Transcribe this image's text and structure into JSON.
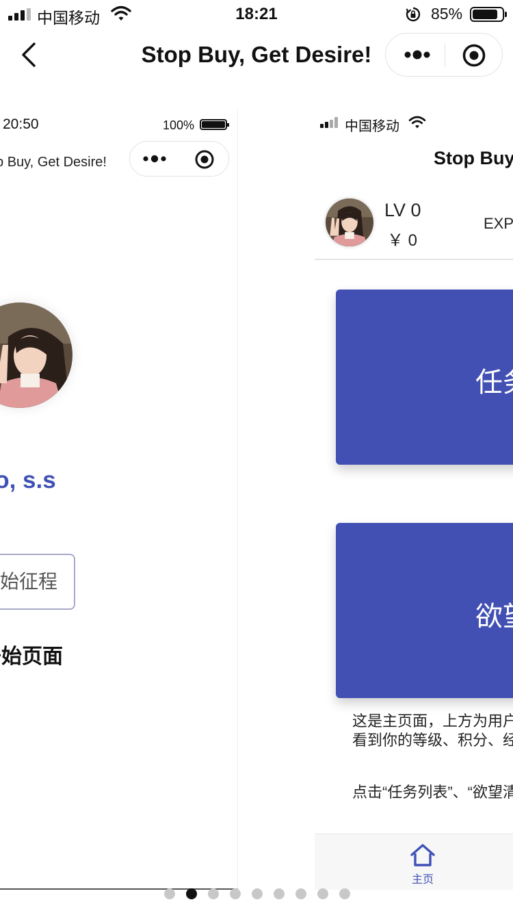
{
  "status_bar": {
    "carrier": "中国移动",
    "time": "18:21",
    "battery_percent": "85%",
    "battery_level": 0.85,
    "icons": [
      "signal-icon",
      "wifi-icon",
      "orientation-lock-icon",
      "battery-icon"
    ]
  },
  "nav": {
    "title": "Stop Buy, Get Desire!",
    "icons": [
      "back-icon",
      "more-icon",
      "target-icon"
    ]
  },
  "left_screenshot": {
    "time": "20:50",
    "battery_percent": "100%",
    "title": "Stop Buy, Get Desire!",
    "greeting": "Hello, s.s",
    "start_button_label": "开始征程",
    "page_label": "开始页面"
  },
  "right_screenshot": {
    "carrier": "中国移动",
    "title": "Stop Buy, Get Desire!",
    "level": "LV 0",
    "coins": "￥ 0",
    "exp_label": "EXP",
    "cards": [
      "任务列表",
      "欲望清单"
    ],
    "description": [
      "这是主页面，上方为用户信息栏，",
      "看到你的等级、积分、经验值。",
      "点击“任务列表”、“欲望清单”"
    ],
    "tabbar": {
      "home_label": "主页"
    }
  },
  "pagination": {
    "total": 9,
    "active": 2
  },
  "colors": {
    "accent": "#3f51b5",
    "card": "#4250b4",
    "dot_active": "#111111",
    "dot_inactive": "#c8c8c8"
  }
}
